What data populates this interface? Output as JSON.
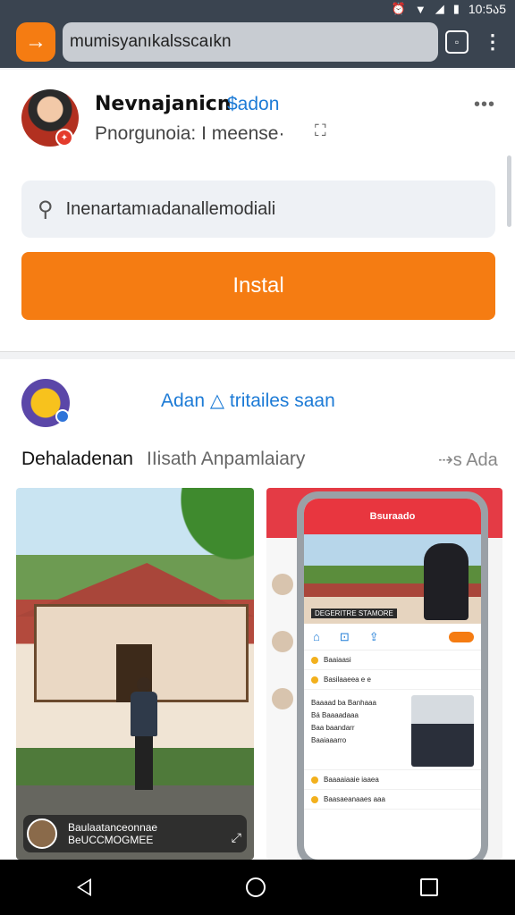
{
  "status_bar": {
    "time": "10:5ა5",
    "icons": [
      "alarm-icon",
      "wifi-icon",
      "signal-icon",
      "battery-icon"
    ]
  },
  "browser": {
    "url": "mumisyanıkalsscaıkn",
    "logo_glyph": "→"
  },
  "app_card": {
    "name": "Nevnajanicn",
    "tag": "$adon",
    "subtitle": "Pnorgunoia:  I meense·",
    "search_placeholder": "Inenartamıadanallemodiali",
    "install_label": "Instal",
    "more_glyph": "•••"
  },
  "brand_card": {
    "title": "Adan",
    "title_rest": "tritailes saan",
    "section_title": "Dehaladenan",
    "section_sub": "IIisath Anpamlaiary",
    "section_more": "⇢s Ada"
  },
  "screenshot1": {
    "overlay_line1": "Baulaatanceonnae",
    "overlay_line2": "BeUCCMOGMEE"
  },
  "screenshot2": {
    "phone_header": "Bsuraado",
    "hero_caption": "DEGERITRE STAMORE",
    "feed_rows": [
      "Baaiaasi",
      "Basilaaeea e e",
      "Baaaaiaaie iaaea",
      "Baasaeanaaes aaa"
    ],
    "feed_block_lines": [
      "Baaaad ba Banhaaa",
      "Bá Baaaadaaa",
      "Baa baandarr",
      "Baaiaaarro"
    ]
  },
  "colors": {
    "accent": "#f57c12",
    "link": "#1d7bd6",
    "topbar": "#3a4450"
  }
}
